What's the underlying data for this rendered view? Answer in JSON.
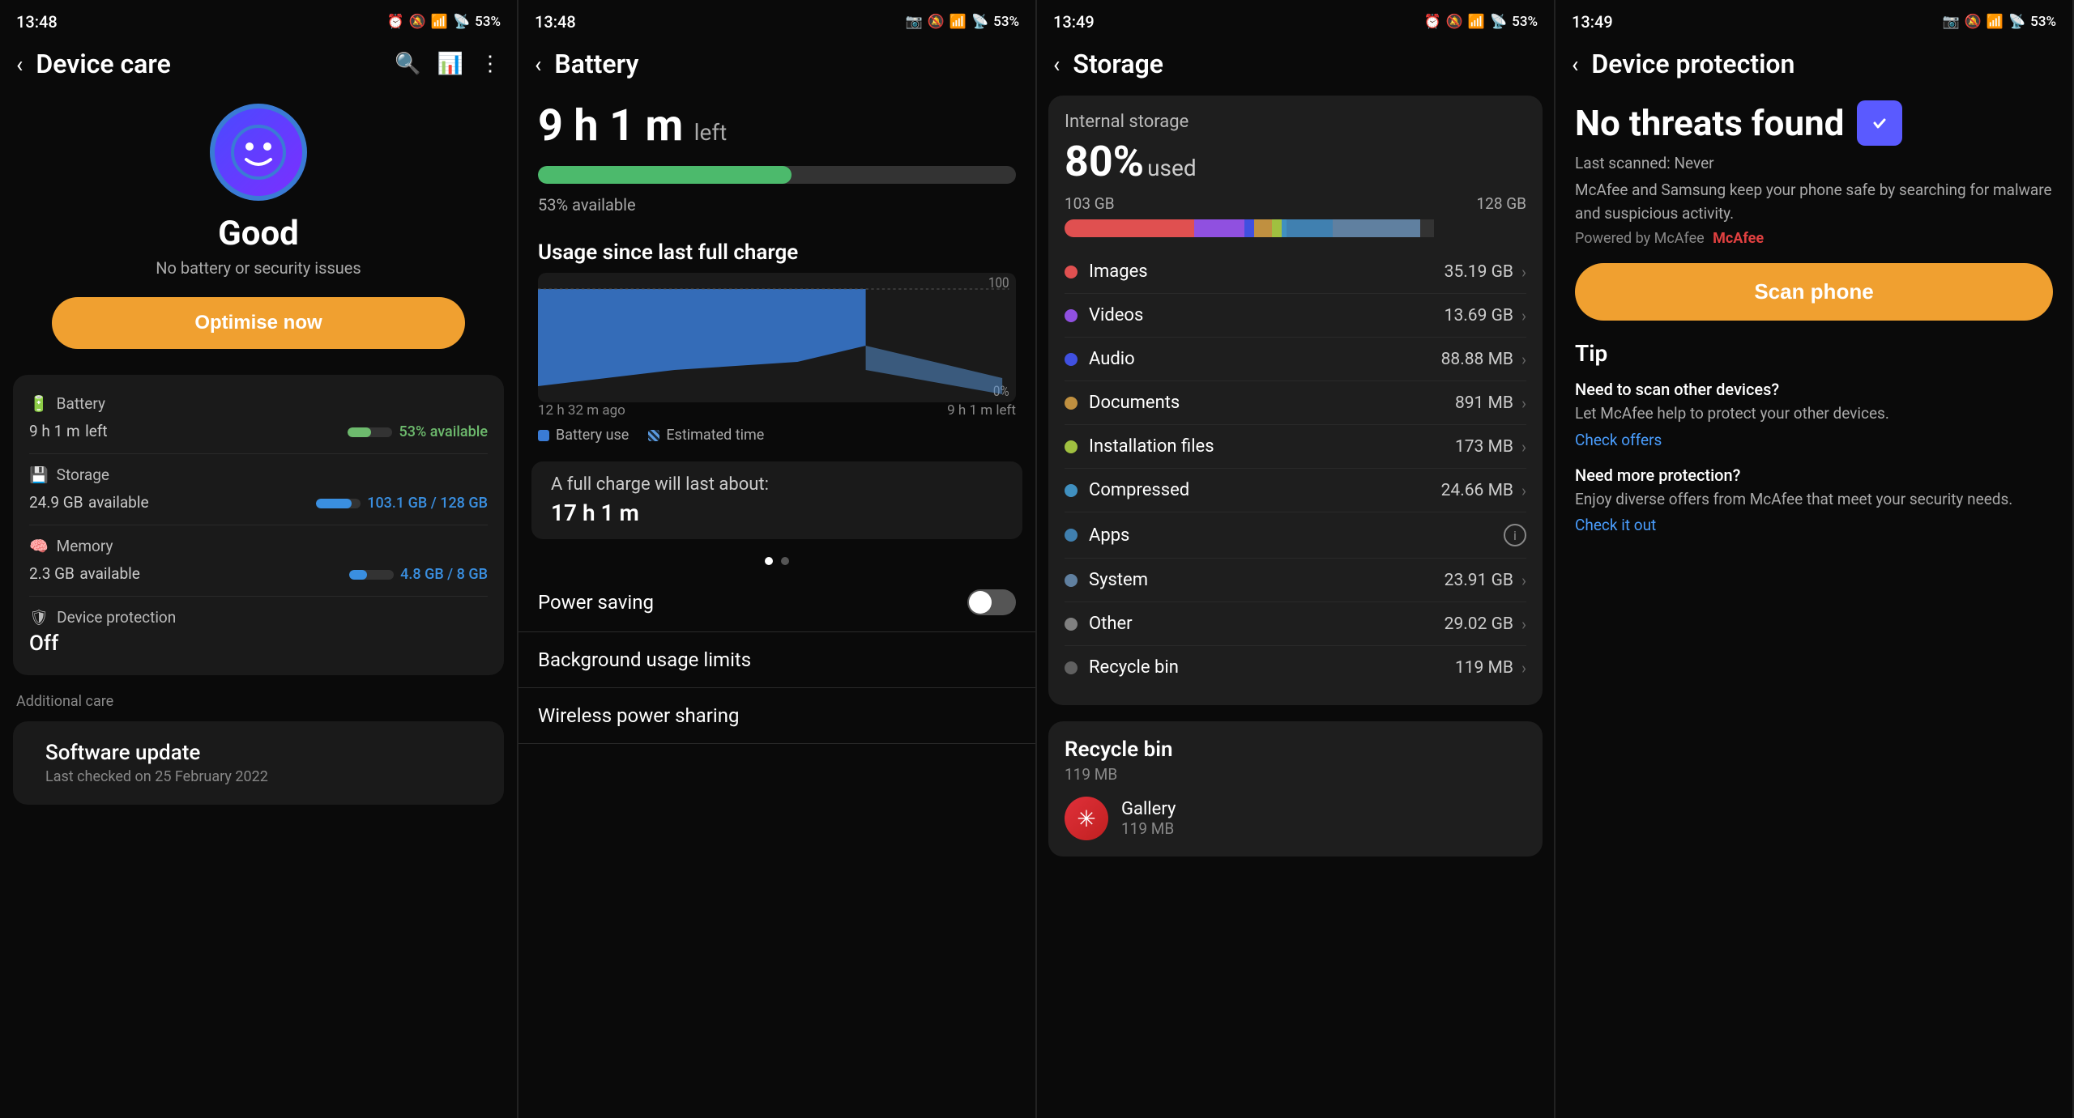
{
  "screens": [
    {
      "id": "device-care",
      "status_bar": {
        "time": "13:48",
        "battery": "53%"
      },
      "nav": {
        "title": "Device care",
        "back": "‹"
      },
      "hero": {
        "status": "Good",
        "subtitle": "No battery or security issues",
        "button": "Optimise now"
      },
      "cards": [
        {
          "icon": "🔋",
          "label": "Battery",
          "value": "9 h 1 m",
          "unit": "left",
          "right": "53% available",
          "bar_type": "battery"
        },
        {
          "icon": "💾",
          "label": "Storage",
          "value": "24.9 GB",
          "unit": "available",
          "right": "103.1 GB / 128 GB",
          "bar_type": "storage"
        },
        {
          "icon": "🧠",
          "label": "Memory",
          "value": "2.3 GB",
          "unit": "available",
          "right": "4.8 GB / 8 GB",
          "bar_type": "memory"
        },
        {
          "icon": "🛡",
          "label": "Device protection",
          "value": "Off",
          "unit": "",
          "right": "",
          "bar_type": "none"
        }
      ],
      "additional_care": {
        "label": "Additional care",
        "items": [
          {
            "title": "Software update",
            "subtitle": "Last checked on 25 February 2022"
          }
        ]
      }
    },
    {
      "id": "battery",
      "status_bar": {
        "time": "13:48",
        "battery": "53%"
      },
      "nav": {
        "title": "Battery",
        "back": "‹"
      },
      "time_left": "9 h 1 m",
      "time_left_label": "left",
      "bar_pct": 53,
      "available": "53% available",
      "usage_section": "Usage since last full charge",
      "chart_labels": {
        "left": "12 h 32 m ago",
        "right": "9 h 1 m left",
        "top": "100",
        "bottom": "0%"
      },
      "legend": [
        {
          "label": "Battery use",
          "color": "#3a7bd5"
        },
        {
          "label": "Estimated time",
          "color": "#5a9ae0",
          "striped": true
        }
      ],
      "full_charge": {
        "label": "A full charge will last about:",
        "value": "17 h 1 m"
      },
      "power_saving": "Power saving",
      "background_usage": "Background usage limits",
      "wireless_power": "Wireless power sharing"
    },
    {
      "id": "storage",
      "status_bar": {
        "time": "13:49",
        "battery": "53%"
      },
      "nav": {
        "title": "Storage",
        "back": "‹"
      },
      "internal": {
        "label": "Internal storage",
        "percent": "80%",
        "used_label": "used",
        "bar_103": "103 GB",
        "bar_128": "128 GB"
      },
      "storage_items": [
        {
          "label": "Images",
          "size": "35.19 GB",
          "color": "#e05050",
          "has_arrow": true
        },
        {
          "label": "Videos",
          "size": "13.69 GB",
          "color": "#9050e0",
          "has_arrow": true
        },
        {
          "label": "Audio",
          "size": "88.88 MB",
          "color": "#4050e0",
          "has_arrow": true
        },
        {
          "label": "Documents",
          "size": "891 MB",
          "color": "#c09040",
          "has_arrow": true
        },
        {
          "label": "Installation files",
          "size": "173 MB",
          "color": "#a0c040",
          "has_arrow": true
        },
        {
          "label": "Compressed",
          "size": "24.66 MB",
          "color": "#4090c0",
          "has_arrow": true
        },
        {
          "label": "Apps",
          "size": "",
          "color": "#4080b0",
          "has_arrow": false,
          "has_info": true
        },
        {
          "label": "System",
          "size": "23.91 GB",
          "color": "#6080a0",
          "has_arrow": true
        },
        {
          "label": "Other",
          "size": "29.02 GB",
          "color": "#808080",
          "has_arrow": true
        },
        {
          "label": "Recycle bin",
          "size": "119 MB",
          "color": "#606060",
          "has_arrow": true
        }
      ],
      "recycle_bin": {
        "title": "Recycle bin",
        "size": "119 MB",
        "items": [
          {
            "app": "Gallery",
            "size": "119 MB",
            "color": "#c02030"
          }
        ]
      }
    },
    {
      "id": "device-protection",
      "status_bar": {
        "time": "13:49",
        "battery": "53%"
      },
      "nav": {
        "title": "Device protection",
        "back": "‹"
      },
      "no_threats": "No threats found",
      "last_scanned": "Last scanned: Never",
      "desc": "McAfee and Samsung keep your phone safe by searching for malware and suspicious activity.",
      "powered_by": "Powered by McAfee",
      "scan_button": "Scan phone",
      "tip_label": "Tip",
      "tip_blocks": [
        {
          "title": "Need to scan other devices?",
          "body": "Let McAfee help to protect your other devices.",
          "link": "Check offers"
        },
        {
          "title": "Need more protection?",
          "body": "Enjoy diverse offers from McAfee that meet your security needs.",
          "link": "Check it out"
        }
      ]
    }
  ]
}
